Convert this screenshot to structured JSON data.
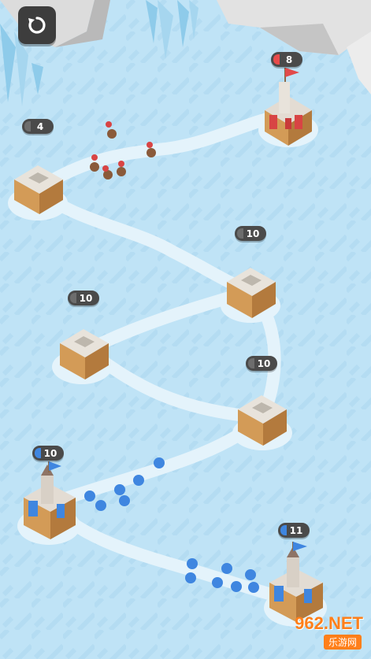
{
  "hud": {
    "restart_icon": "restart-icon"
  },
  "colors": {
    "enemy": "#e84b4b",
    "player": "#3f86e0",
    "neutral": "#6d6d6d",
    "snow": "#e4f3fb",
    "ground": "#bfe3f6"
  },
  "bases": [
    {
      "id": "enemy-castle",
      "count": "8",
      "owner": "enemy"
    },
    {
      "id": "enemy-house",
      "count": "4",
      "owner": "neutral"
    },
    {
      "id": "neutral-house-1",
      "count": "10",
      "owner": "neutral"
    },
    {
      "id": "neutral-house-2",
      "count": "10",
      "owner": "neutral"
    },
    {
      "id": "neutral-house-3",
      "count": "10",
      "owner": "neutral"
    },
    {
      "id": "player-castle-1",
      "count": "10",
      "owner": "player"
    },
    {
      "id": "player-castle-2",
      "count": "11",
      "owner": "player"
    }
  ],
  "watermark": {
    "text": "962.NET",
    "sub": "乐游网"
  }
}
